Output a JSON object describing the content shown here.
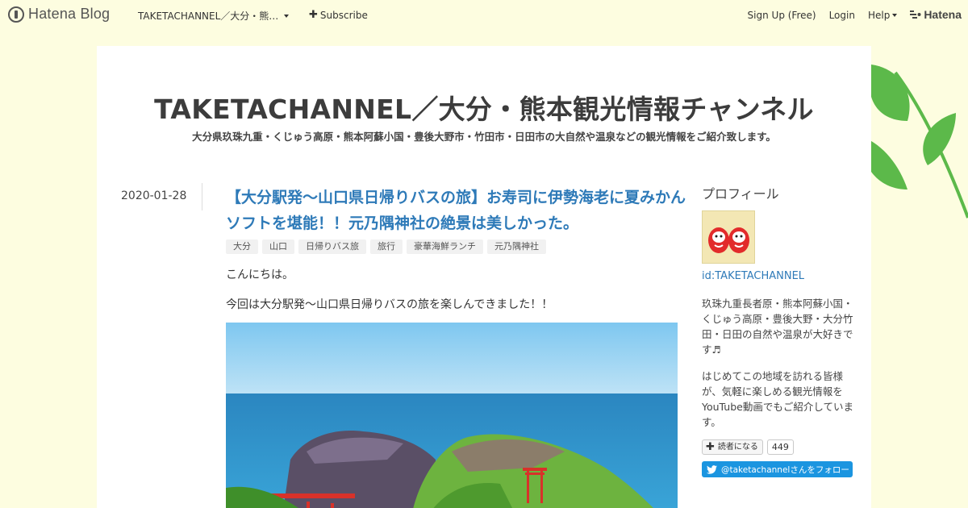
{
  "global_header": {
    "brand": "Hatena Blog",
    "blog_selector": "TAKETACHANNEL／大分・熊…",
    "subscribe": "Subscribe",
    "signup": "Sign Up (Free)",
    "login": "Login",
    "help": "Help",
    "hatena": "Hatena"
  },
  "blog": {
    "title": "TAKETACHANNEL／大分・熊本観光情報チャンネル",
    "description": "大分県玖珠九重・くじゅう高原・熊本阿蘇小国・豊後大野市・竹田市・日田市の大自然や温泉などの観光情報をご紹介致します。"
  },
  "entry": {
    "date": "2020-01-28",
    "title": "【大分駅発～山口県日帰りバスの旅】お寿司に伊勢海老に夏みかんソフトを堪能！！元乃隅神社の絶景は美しかった。",
    "tags": [
      "大分",
      "山口",
      "日帰りバス旅",
      "旅行",
      "豪華海鮮ランチ",
      "元乃隅神社"
    ],
    "paragraphs": [
      "こんにちは。",
      "今回は大分駅発～山口県日帰りバスの旅を楽しんできました！！"
    ]
  },
  "sidebar": {
    "heading": "プロフィール",
    "user_id": "id:TAKETACHANNEL",
    "bio1": "玖珠九重長者原・熊本阿蘇小国・くじゅう高原・豊後大野・大分竹田・日田の自然や温泉が大好きです♬",
    "bio2": "はじめてこの地域を訪れる皆様が、気軽に楽しめる観光情報をYouTube動画でもご紹介しています。",
    "reader_button": "読者になる",
    "reader_count": "449",
    "twitter_follow": "@taketachannelさんをフォロー"
  },
  "colors": {
    "page_bg": "#fdfde0",
    "link": "#2e7ab8",
    "twitter": "#1b95e0",
    "leaf": "#5cb94a"
  }
}
